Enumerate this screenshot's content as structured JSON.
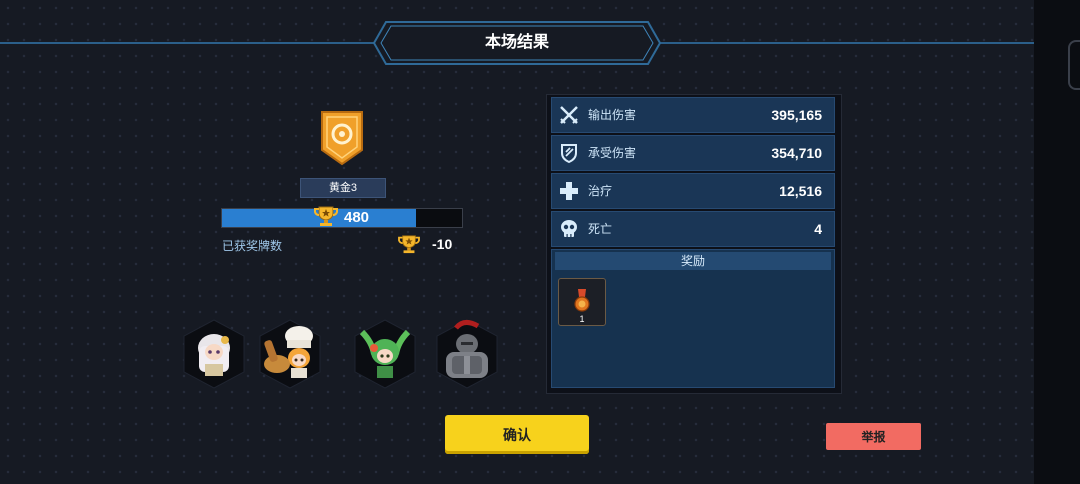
{
  "header": {
    "title": "本场结果"
  },
  "rank": {
    "tier_label": "黄金3",
    "trophies": "480",
    "progress_fraction": 0.81
  },
  "medals": {
    "label": "已获奖牌数",
    "value": "-10"
  },
  "heroes": [
    {
      "name": "white-haired-hero"
    },
    {
      "name": "chef-hero"
    },
    {
      "name": "green-haired-hero"
    },
    {
      "name": "armored-knight-hero"
    }
  ],
  "stats": [
    {
      "icon": "crossed-swords-icon",
      "label": "输出伤害",
      "value": "395,165"
    },
    {
      "icon": "shield-icon",
      "label": "承受伤害",
      "value": "354,710"
    },
    {
      "icon": "plus-icon",
      "label": "治疗",
      "value": "12,516"
    },
    {
      "icon": "skull-icon",
      "label": "死亡",
      "value": "4"
    }
  ],
  "rewards": {
    "header": "奖励",
    "items": [
      {
        "icon": "medal-icon",
        "count": "1"
      }
    ]
  },
  "buttons": {
    "confirm": "确认",
    "report": "举报"
  },
  "colors": {
    "accent": "#f7d21c",
    "report": "#f26b62",
    "panel": "#1a3656",
    "progress": "#2a7fd1"
  }
}
